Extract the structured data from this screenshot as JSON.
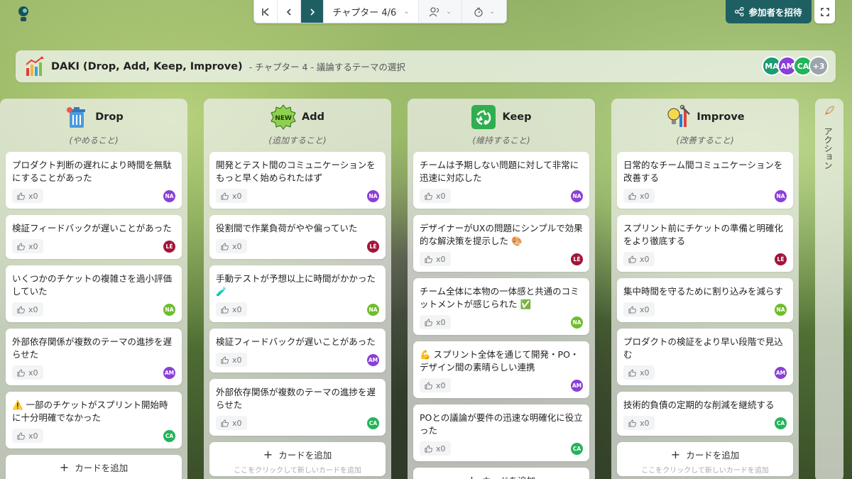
{
  "toolbar": {
    "chapter_label": "チャプター 4/6"
  },
  "invite": {
    "label": "参加者を招待"
  },
  "header": {
    "title": "DAKI (Drop, Add, Keep, Improve)",
    "subtitle": "- チャプター 4 - 議論するテーマの選択",
    "avatars": [
      {
        "initials": "MA",
        "color": "#1a9b72"
      },
      {
        "initials": "AM",
        "color": "#8a3fd6"
      },
      {
        "initials": "CA",
        "color": "#22b45a"
      },
      {
        "initials": "+3",
        "color": "#9aa4ab"
      }
    ]
  },
  "action_tab": {
    "label": "アクション"
  },
  "add_card": {
    "label": "カードを追加",
    "hint": "ここをクリックして新しいカードを追加"
  },
  "colors": {
    "NA": "#8a3fd6",
    "LE": "#a3143b",
    "NA2": "#6fbd2c",
    "AM": "#8a3fd6",
    "CA": "#22b45a"
  },
  "columns": [
    {
      "title": "Drop",
      "subtitle": "(やめること)",
      "icon": "trash-icon",
      "cards": [
        {
          "text": "プロダクト判断の遅れにより時間を無駄にすることがあった",
          "likes": "x0",
          "author": "NA",
          "color": "#8a3fd6"
        },
        {
          "text": "検証フィードバックが遅いことがあった",
          "likes": "x0",
          "author": "LÉ",
          "color": "#a3143b"
        },
        {
          "text": "いくつかのチケットの複雑さを過小評価していた",
          "likes": "x0",
          "author": "NA",
          "color": "#6fbd2c"
        },
        {
          "text": "外部依存関係が複数のテーマの進捗を遅らせた",
          "likes": "x0",
          "author": "AM",
          "color": "#8a3fd6"
        },
        {
          "text": "⚠️ 一部のチケットがスプリント開始時に十分明確でなかった",
          "likes": "x0",
          "author": "CA",
          "color": "#22b45a"
        }
      ]
    },
    {
      "title": "Add",
      "subtitle": "(追加すること)",
      "icon": "new-badge-icon",
      "cards": [
        {
          "text": "開発とテスト間のコミュニケーションをもっと早く始められたはず",
          "likes": "x0",
          "author": "NA",
          "color": "#8a3fd6"
        },
        {
          "text": "役割間で作業負荷がやや偏っていた",
          "likes": "x0",
          "author": "LÉ",
          "color": "#a3143b"
        },
        {
          "text": "手動テストが予想以上に時間がかかった 🧪",
          "likes": "x0",
          "author": "NA",
          "color": "#6fbd2c"
        },
        {
          "text": "検証フィードバックが遅いことがあった",
          "likes": "x0",
          "author": "AM",
          "color": "#8a3fd6"
        },
        {
          "text": "外部依存関係が複数のテーマの進捗を遅らせた",
          "likes": "x0",
          "author": "CA",
          "color": "#22b45a"
        }
      ]
    },
    {
      "title": "Keep",
      "subtitle": "(維持すること)",
      "icon": "recycle-icon",
      "cards": [
        {
          "text": "チームは予期しない問題に対して非常に迅速に対応した",
          "likes": "x0",
          "author": "NA",
          "color": "#8a3fd6"
        },
        {
          "text": "デザイナーがUXの問題にシンプルで効果的な解決策を提示した 🎨",
          "likes": "x0",
          "author": "LÉ",
          "color": "#a3143b"
        },
        {
          "text": "チーム全体に本物の一体感と共通のコミットメントが感じられた ✅",
          "likes": "x0",
          "author": "NA",
          "color": "#6fbd2c"
        },
        {
          "text": "💪 スプリント全体を通じて開発・PO・デザイン間の素晴らしい連携",
          "likes": "x0",
          "author": "AM",
          "color": "#8a3fd6"
        },
        {
          "text": "POとの議論が要件の迅速な明確化に役立った",
          "likes": "x0",
          "author": "CA",
          "color": "#22b45a"
        }
      ]
    },
    {
      "title": "Improve",
      "subtitle": "(改善すること)",
      "icon": "tools-icon",
      "cards": [
        {
          "text": "日常的なチーム間コミュニケーションを改善する",
          "likes": "x0",
          "author": "NA",
          "color": "#8a3fd6"
        },
        {
          "text": "スプリント前にチケットの準備と明確化をより徹底する",
          "likes": "x0",
          "author": "LÉ",
          "color": "#a3143b"
        },
        {
          "text": "集中時間を守るために割り込みを減らす",
          "likes": "x0",
          "author": "NA",
          "color": "#6fbd2c"
        },
        {
          "text": "プロダクトの検証をより早い段階で見込む",
          "likes": "x0",
          "author": "AM",
          "color": "#8a3fd6"
        },
        {
          "text": "技術的負債の定期的な削減を継続する",
          "likes": "x0",
          "author": "CA",
          "color": "#22b45a"
        }
      ]
    }
  ]
}
